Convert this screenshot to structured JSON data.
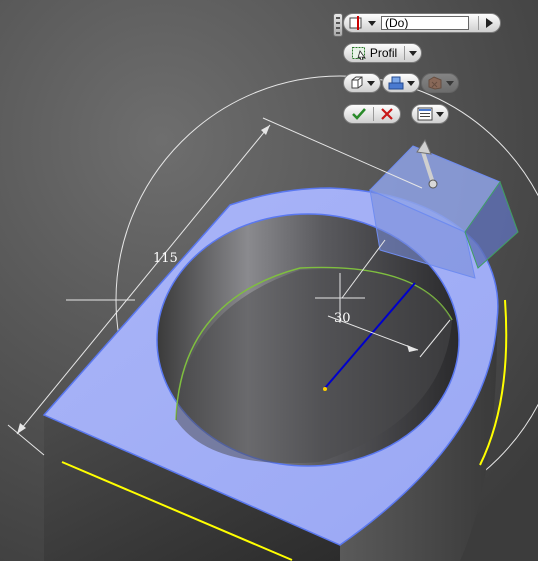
{
  "viewport": {
    "dimensions": {
      "overall": "115",
      "distance": "30"
    }
  },
  "mini_toolbar": {
    "distance_value": "(Do)",
    "profile_label": "Profil",
    "icons": {
      "direction": "extent-direction-icon",
      "profile": "profile-select-icon",
      "output_solid": "solid-output-icon",
      "operation": "join-operation-icon",
      "operation_disabled": "cut-operation-icon",
      "ok": "checkmark-icon",
      "cancel": "cancel-x-icon",
      "options": "options-list-icon"
    }
  },
  "colors": {
    "selection": "#7f8ff0",
    "edge_highlight": "#ffff00",
    "axis": "#0000cc",
    "ok_green": "#2a8a2a",
    "cancel_red": "#c81818"
  }
}
